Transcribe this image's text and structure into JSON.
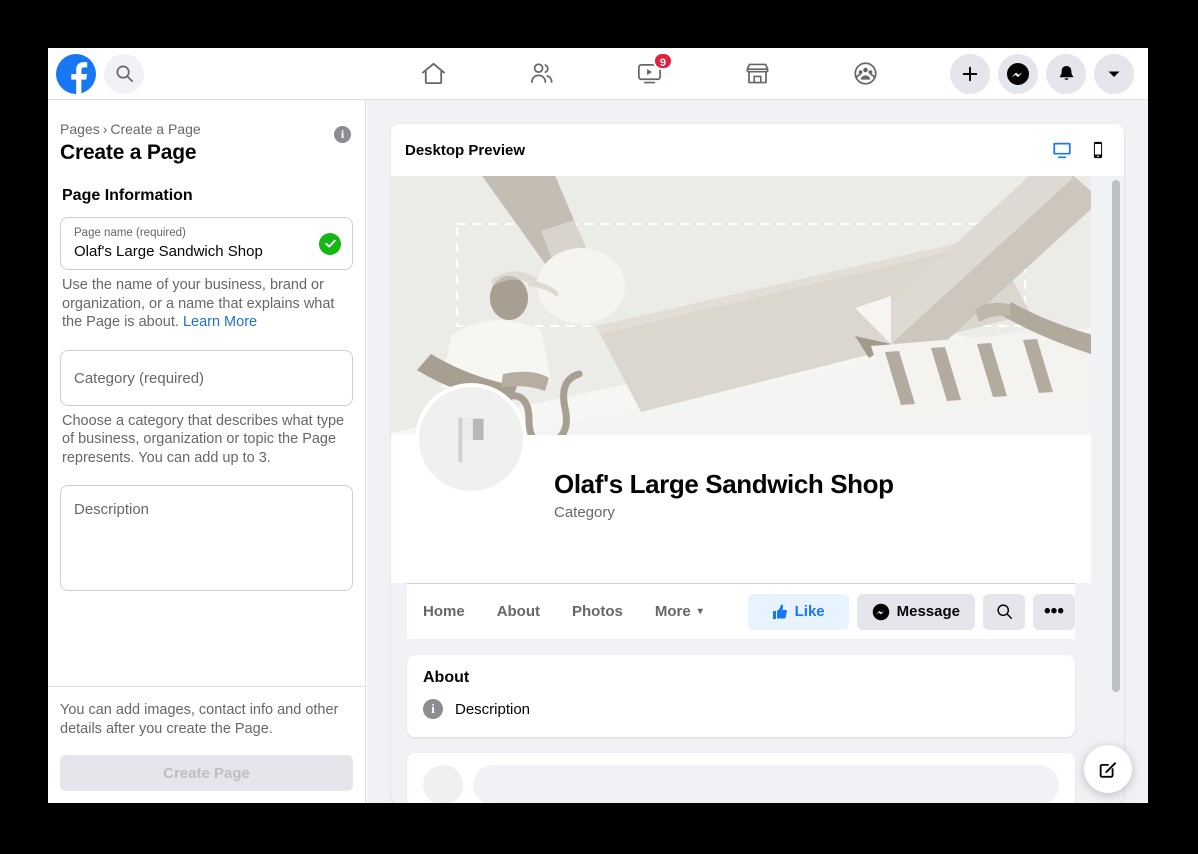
{
  "colors": {
    "brand_blue": "#1877f2",
    "link_blue": "#216fdb",
    "badge_red": "#e41e3f",
    "success_green": "#14b714",
    "page_bg": "#f0f2f5",
    "cover_bg": "#ebebe7"
  },
  "topnav": {
    "logo": "facebook-logo",
    "search_placeholder": "Search Facebook",
    "tabs": [
      {
        "id": "home",
        "icon": "home-icon",
        "badge": ""
      },
      {
        "id": "friends",
        "icon": "friends-icon",
        "badge": ""
      },
      {
        "id": "watch",
        "icon": "watch-video-icon",
        "badge": "9"
      },
      {
        "id": "marketplace",
        "icon": "marketplace-shop-icon",
        "badge": ""
      },
      {
        "id": "groups",
        "icon": "groups-icon",
        "badge": ""
      }
    ],
    "actions": [
      {
        "id": "create",
        "icon": "plus-icon"
      },
      {
        "id": "messenger",
        "icon": "messenger-icon"
      },
      {
        "id": "notifications",
        "icon": "bell-icon"
      },
      {
        "id": "account",
        "icon": "chevron-down-icon"
      }
    ]
  },
  "sidebar": {
    "breadcrumb_root": "Pages",
    "breadcrumb_separator": "›",
    "breadcrumb_current": "Create a Page",
    "page_title": "Create a Page",
    "info_icon_glyph": "i",
    "section_title": "Page Information",
    "fields": {
      "page_name": {
        "label": "Page name (required)",
        "value": "Olaf's Large Sandwich Shop",
        "status": "valid",
        "helper": "Use the name of your business, brand or organization, or a name that explains what the Page is about.",
        "helper_link": "Learn More"
      },
      "category": {
        "placeholder": "Category (required)",
        "value": "",
        "helper": "Choose a category that describes what type of business, organization or topic the Page represents. You can add up to 3."
      },
      "description": {
        "placeholder": "Description",
        "value": ""
      }
    },
    "footer_note": "You can add images, contact info and other details after you create the Page.",
    "create_button": "Create Page"
  },
  "preview": {
    "header_title": "Desktop Preview",
    "view_toggles": [
      {
        "id": "desktop",
        "icon": "desktop-monitor-icon",
        "active": true
      },
      {
        "id": "mobile",
        "icon": "mobile-phone-icon",
        "active": false
      }
    ],
    "page": {
      "cover_alt": "cover-placeholder-illustration",
      "avatar_icon": "flag-placeholder-icon",
      "name": "Olaf's Large Sandwich Shop",
      "category": "Category",
      "tabs": [
        {
          "label": "Home"
        },
        {
          "label": "About"
        },
        {
          "label": "Photos"
        },
        {
          "label": "More",
          "caret": "▾"
        }
      ],
      "like_button": "Like",
      "like_icon": "thumbs-up-icon",
      "message_button": "Message",
      "message_icon": "messenger-icon",
      "search_icon": "search-icon",
      "more_icon": "ellipsis-icon",
      "about_card": {
        "title": "About",
        "info_icon_glyph": "i",
        "description": "Description"
      }
    }
  },
  "fab": {
    "icon": "compose-edit-icon"
  }
}
